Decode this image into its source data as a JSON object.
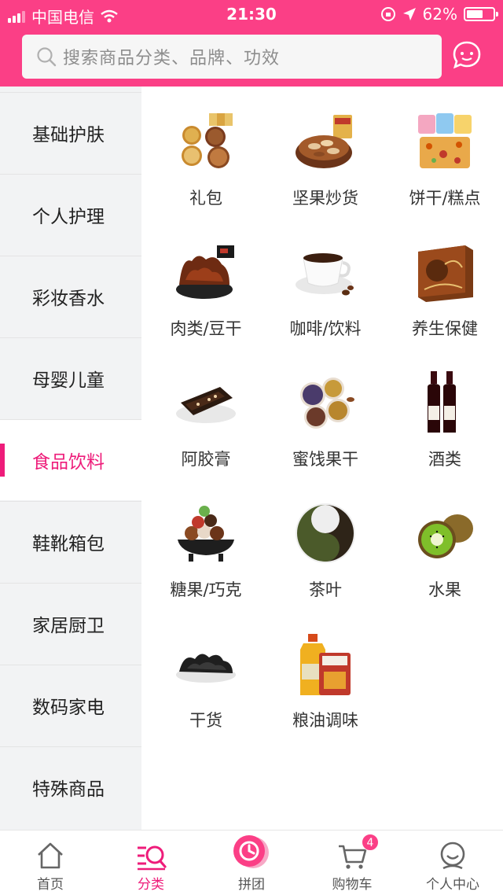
{
  "status_bar": {
    "carrier": "中国电信",
    "time": "21:30",
    "battery": "62%",
    "battery_level": 0.62
  },
  "search": {
    "placeholder": "搜索商品分类、品牌、功效",
    "icon": "search-icon",
    "message_icon": "message-icon"
  },
  "sidebar": {
    "active_index": 4,
    "items": [
      {
        "label": "基础护肤"
      },
      {
        "label": "个人护理"
      },
      {
        "label": "彩妆香水"
      },
      {
        "label": "母婴儿童"
      },
      {
        "label": "食品饮料"
      },
      {
        "label": "鞋靴箱包"
      },
      {
        "label": "家居厨卫"
      },
      {
        "label": "数码家电"
      },
      {
        "label": "特殊商品"
      }
    ]
  },
  "categories": [
    {
      "label": "礼包",
      "icon": "gift-pack-image"
    },
    {
      "label": "坚果炒货",
      "icon": "nuts-image"
    },
    {
      "label": "饼干/糕点",
      "icon": "biscuits-image"
    },
    {
      "label": "肉类/豆干",
      "icon": "meat-image"
    },
    {
      "label": "咖啡/饮料",
      "icon": "coffee-image"
    },
    {
      "label": "养生保健",
      "icon": "health-box-image"
    },
    {
      "label": "阿胶膏",
      "icon": "ejiao-image"
    },
    {
      "label": "蜜饯果干",
      "icon": "dried-fruit-image"
    },
    {
      "label": "酒类",
      "icon": "wine-image"
    },
    {
      "label": "糖果/巧克",
      "icon": "candy-image"
    },
    {
      "label": "茶叶",
      "icon": "tea-image"
    },
    {
      "label": "水果",
      "icon": "kiwi-image"
    },
    {
      "label": "干货",
      "icon": "dried-goods-image"
    },
    {
      "label": "粮油调味",
      "icon": "oil-seasoning-image"
    }
  ],
  "tabbar": {
    "active_index": 1,
    "items": [
      {
        "label": "首页",
        "icon": "home-icon"
      },
      {
        "label": "分类",
        "icon": "category-icon"
      },
      {
        "label": "拼团",
        "icon": "group-buy-icon"
      },
      {
        "label": "购物车",
        "icon": "cart-icon",
        "badge": "4"
      },
      {
        "label": "个人中心",
        "icon": "profile-icon"
      }
    ]
  },
  "colors": {
    "brand": "#fb3f86",
    "active": "#ee1c7a"
  }
}
